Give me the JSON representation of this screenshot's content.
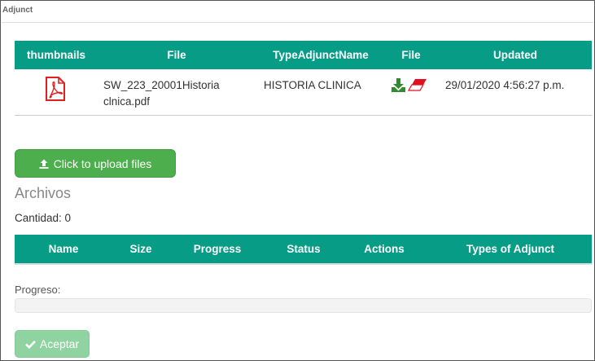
{
  "panel": {
    "title": "Adjunct"
  },
  "files_table": {
    "headers": [
      "thumbnails",
      "File",
      "TypeAdjunctName",
      "File",
      "Updated"
    ],
    "rows": [
      {
        "thumbnail_icon": "pdf-file-icon",
        "file_name": "SW_223_20001Historia clnica.pdf",
        "type_adjunct_name": "HISTORIA CLINICA",
        "actions": [
          "download-icon",
          "eraser-icon"
        ],
        "updated": "29/01/2020 4:56:27 p.m."
      }
    ]
  },
  "upload": {
    "label": "Click to upload files",
    "icon": "upload-icon"
  },
  "archivos": {
    "title": "Archivos",
    "count_label": "Cantidad: 0"
  },
  "queue_table": {
    "headers": [
      "Name",
      "Size",
      "Progress",
      "Status",
      "Actions",
      "Types of Adjunct"
    ]
  },
  "progress": {
    "label": "Progreso:",
    "value_percent": 0
  },
  "accept": {
    "label": "Aceptar",
    "icon": "check-icon"
  },
  "colors": {
    "header_bg": "#079c86",
    "upload_btn": "#4cae4c",
    "accept_btn_disabled": "#8fd4a0",
    "pdf_icon": "#e02020",
    "download_icon": "#2e8b2e",
    "eraser_icon": "#e01020"
  }
}
